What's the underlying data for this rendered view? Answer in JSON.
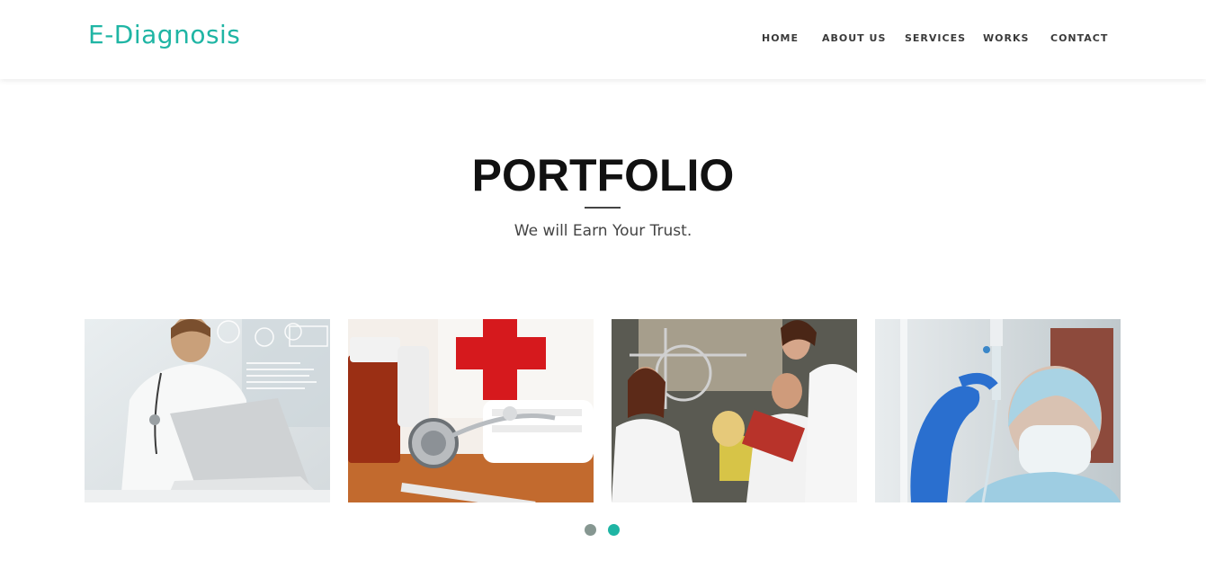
{
  "brand": {
    "name": "E-Diagnosis",
    "color": "#1fb5a4"
  },
  "nav": {
    "items": [
      {
        "label": "HOME"
      },
      {
        "label": "ABOUT US"
      },
      {
        "label": "SERVICES"
      },
      {
        "label": "WORKS"
      },
      {
        "label": "CONTACT"
      }
    ]
  },
  "portfolio": {
    "title": "PORTFOLIO",
    "subtitle": "We will Earn Your Trust.",
    "images": [
      {
        "subject": "doctor-with-laptop"
      },
      {
        "subject": "first-aid-supplies"
      },
      {
        "subject": "lab-researchers"
      },
      {
        "subject": "nurse-with-iv-drip"
      }
    ],
    "carousel": {
      "page_count": 2,
      "active_page": 2
    }
  },
  "colors": {
    "accent": "#1fb5a4",
    "dot_inactive": "#869791",
    "title": "#111111"
  }
}
